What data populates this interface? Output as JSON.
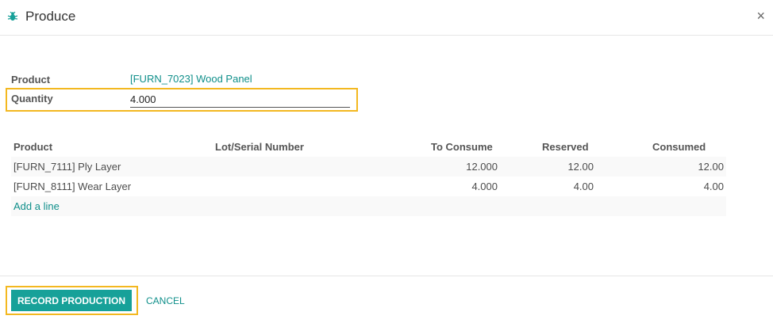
{
  "dialog": {
    "title": "Produce",
    "close_glyph": "×",
    "icon": "bug-icon"
  },
  "form": {
    "product_label": "Product",
    "product_value": "[FURN_7023] Wood Panel",
    "quantity_label": "Quantity",
    "quantity_value": "4.000"
  },
  "table": {
    "headers": {
      "product": "Product",
      "lot": "Lot/Serial Number",
      "to_consume": "To Consume",
      "reserved": "Reserved",
      "consumed": "Consumed"
    },
    "rows": [
      {
        "product": "[FURN_7111] Ply Layer",
        "lot": "",
        "to_consume": "12.000",
        "reserved": "12.00",
        "consumed": "12.00"
      },
      {
        "product": "[FURN_8111] Wear Layer",
        "lot": "",
        "to_consume": "4.000",
        "reserved": "4.00",
        "consumed": "4.00"
      }
    ],
    "add_line": "Add a line"
  },
  "footer": {
    "record_label": "RECORD PRODUCTION",
    "cancel_label": "CANCEL"
  },
  "colors": {
    "accent": "#17a199",
    "link": "#0f8f8a",
    "highlight": "#f3b820"
  }
}
